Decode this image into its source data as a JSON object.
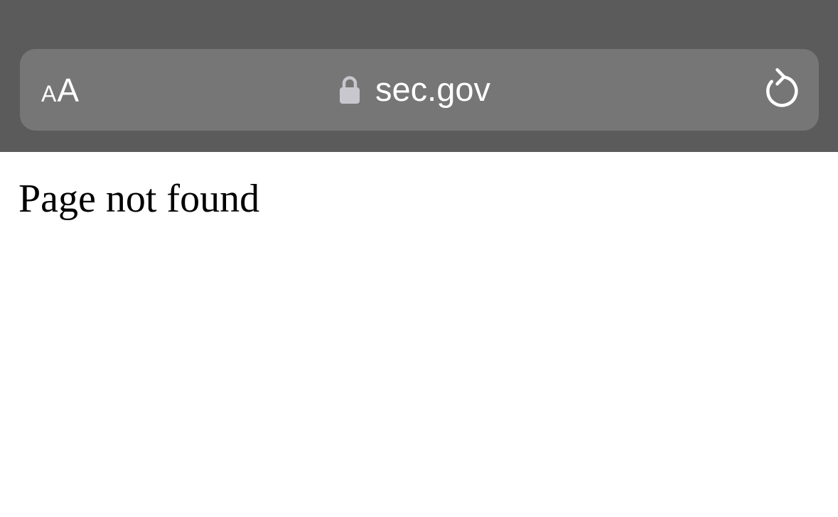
{
  "browser": {
    "text_size_button": {
      "small_label": "A",
      "large_label": "A",
      "icon": "text-size-icon"
    },
    "address_bar": {
      "url": "sec.gov",
      "secure_icon": "lock-icon",
      "reload_icon": "reload-icon"
    },
    "colors": {
      "toolbar": "#5b5b5b",
      "address_bar": "#767676",
      "lock": "#c8c7cd",
      "text": "#ffffff"
    }
  },
  "page": {
    "heading": "Page not found",
    "background": "#ffffff"
  }
}
